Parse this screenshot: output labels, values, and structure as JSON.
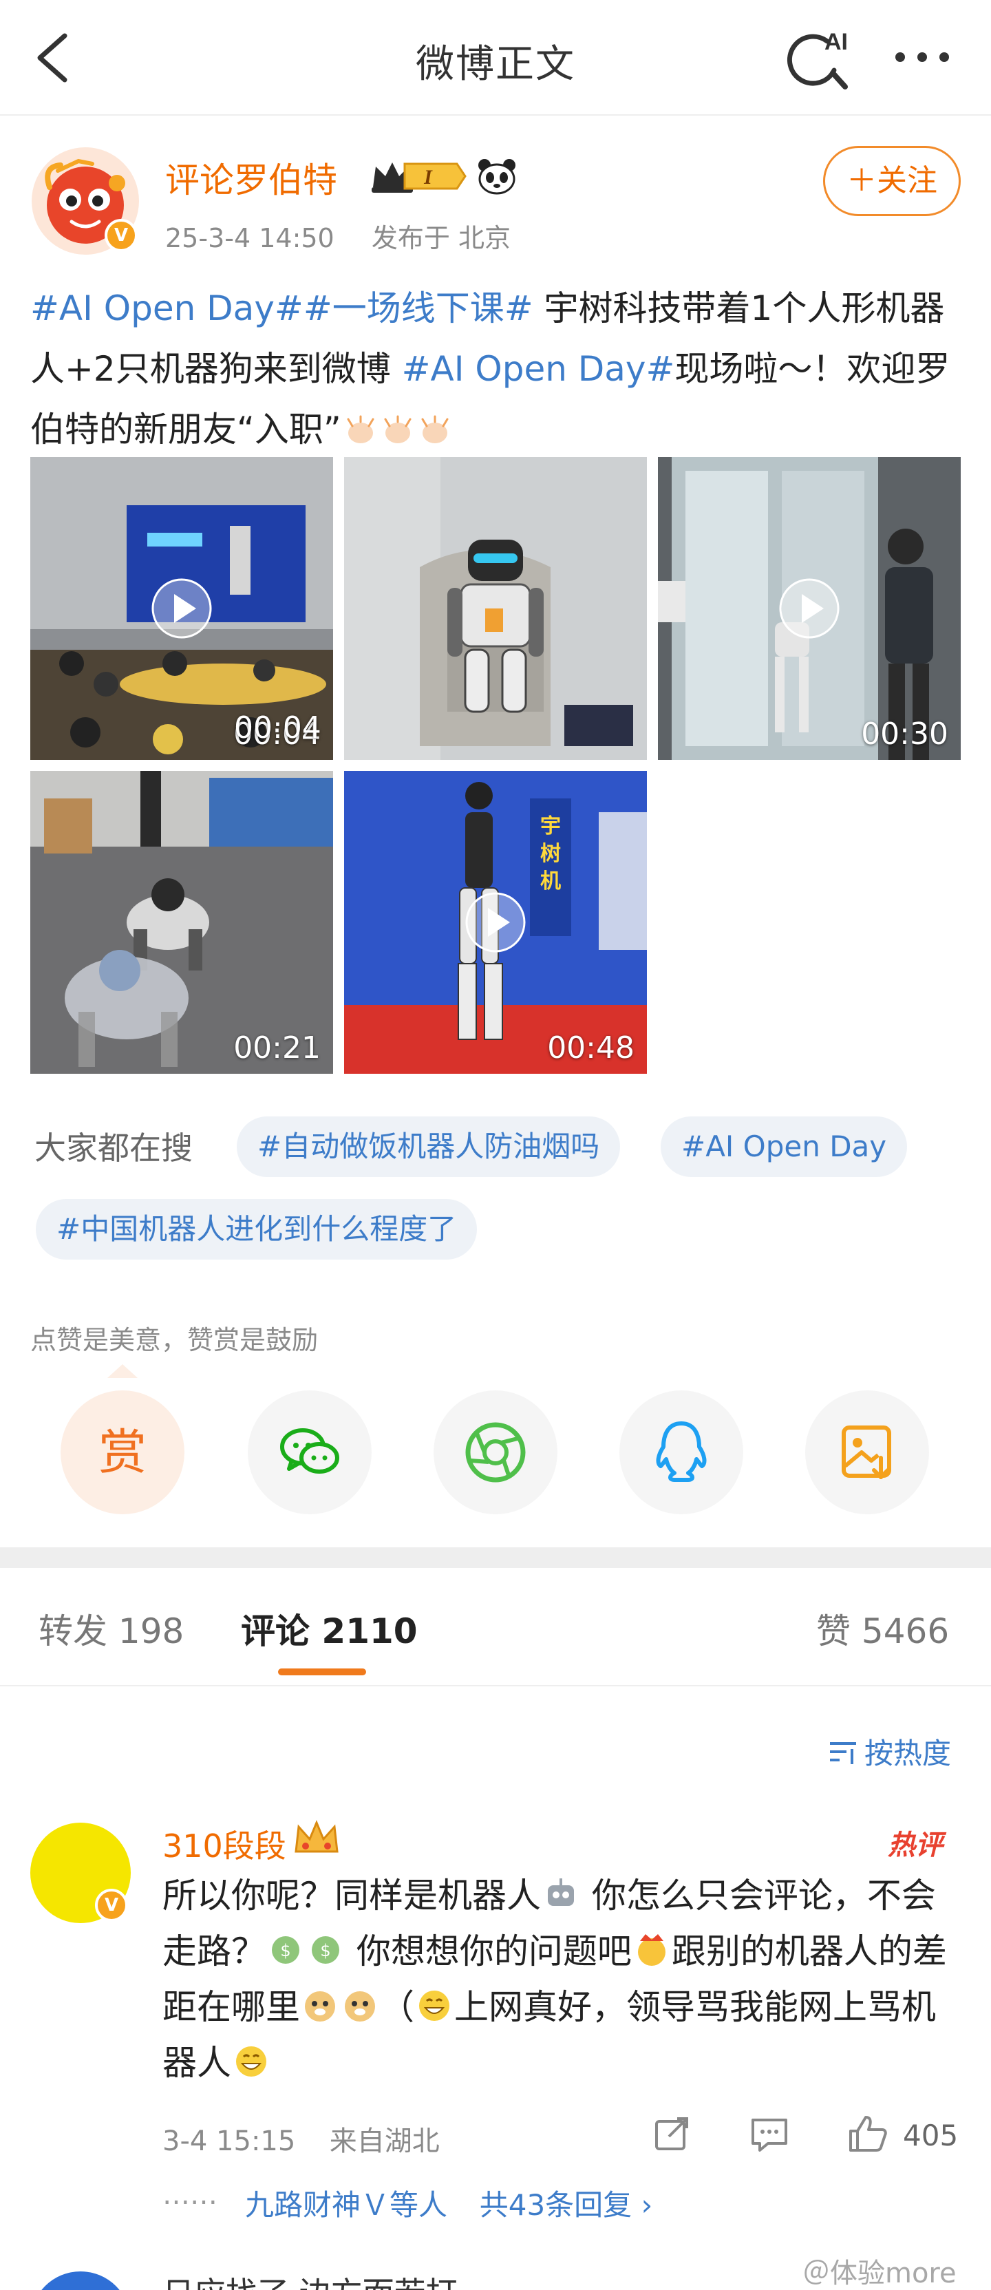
{
  "nav": {
    "title": "微博正文",
    "ai_label": "AI"
  },
  "author": {
    "name": "评论罗伯特",
    "level_badge": "I",
    "time": "25-3-4 14:50",
    "location": "发布于 北京",
    "follow_label": "＋关注",
    "verified_mark": "V"
  },
  "post": {
    "tag1": "#AI Open Day#",
    "tag2": "#一场线下课#",
    "text1": " 宇树科技带着1个人形机器人+2只机器狗来到微博 ",
    "tag3": "#AI Open Day#",
    "text2": "现场啦～！欢迎罗伯特的新朋友“入职”"
  },
  "videos": [
    {
      "duration": "00:04"
    },
    {
      "duration": ""
    },
    {
      "duration": "00:30"
    },
    {
      "duration": "00:21"
    },
    {
      "duration": "00:48"
    }
  ],
  "search": {
    "label": "大家都在搜",
    "chips": [
      "#自动做饭机器人防油烟吗",
      "#AI Open Day",
      "#中国机器人进化到什么程度了"
    ]
  },
  "reward": {
    "text": "点赞是美意，赞赏是鼓励",
    "reward_char": "赏"
  },
  "tabs": {
    "repost": "转发 198",
    "comment": "评论 2110",
    "like": "赞 5466"
  },
  "sort_label": "按热度",
  "comment": {
    "user": "310段段",
    "hot_label": "热评",
    "body_1": "所以你呢？同样是机器人",
    "body_2": " 你怎么只会评论，不会走路？",
    "body_3": " 你想想你的问题吧",
    "body_4": "跟别的机器人的差距在哪里",
    "body_5": "（",
    "body_6": "上网真好，领导骂我能网上骂机器人",
    "time": "3-4 15:15",
    "location": "来自湖北",
    "likes": "405",
    "reply_dots": "……",
    "reply_user": "九路财神Ｖ等人",
    "reply_count": "共43条回复 ›"
  },
  "next_comment": {
    "text": "日应找了 边方而若打"
  },
  "watermark": "＠体验more",
  "colors": {
    "accent_orange": "#f06b00",
    "link_blue": "#3d7cc9",
    "hot_red": "#e8412f",
    "wechat_green": "#1aad19",
    "moments_green": "#4fbf4a",
    "qq_blue": "#1da0f2",
    "save_orange": "#f4a11c"
  },
  "icons": [
    "back-icon",
    "ai-search-icon",
    "more-icon",
    "panda-icon",
    "crown-badge-icon",
    "play-icon",
    "wechat-icon",
    "moments-icon",
    "qq-icon",
    "save-image-icon",
    "sort-icon",
    "repost-icon",
    "comment-icon",
    "like-icon",
    "robot-emoji",
    "money-emoji",
    "crown-emoji",
    "doge-emoji",
    "grin-emoji",
    "clap-emoji"
  ]
}
